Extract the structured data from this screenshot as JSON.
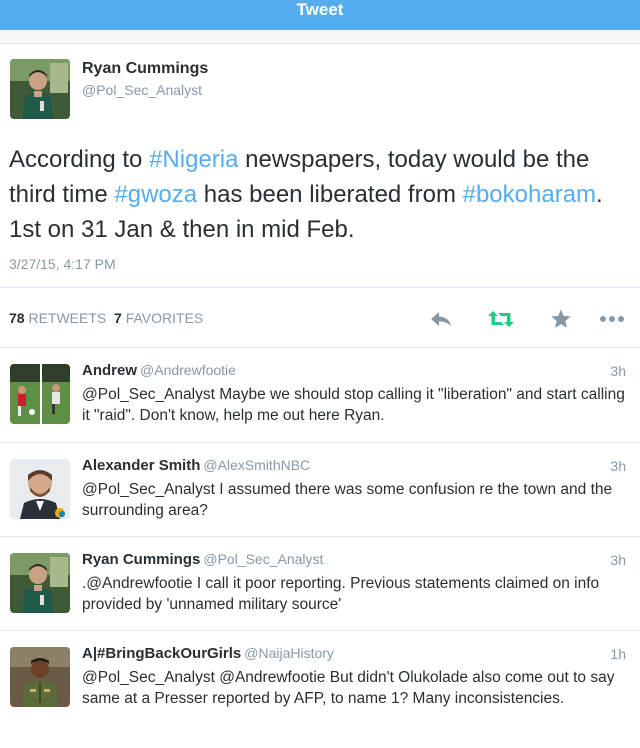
{
  "header": {
    "title": "Tweet"
  },
  "main_tweet": {
    "name": "Ryan Cummings",
    "handle": "@Pol_Sec_Analyst",
    "text_parts": [
      "According to ",
      "#Nigeria",
      " newspapers, today would be the third time ",
      "#gwoza",
      " has been liberated from ",
      "#bokoharam",
      ". 1st on 31 Jan & then in mid Feb."
    ],
    "timestamp": "3/27/15, 4:17 PM",
    "retweets_count": "78",
    "retweets_label": "RETWEETS",
    "favorites_count": "7",
    "favorites_label": "FAVORITES",
    "actions": [
      "reply-icon",
      "retweet-icon",
      "favorite-icon",
      "more-icon"
    ],
    "colors": {
      "accent": "#55acee",
      "retweet_green": "#19cf86",
      "muted": "#8899a6",
      "action_gray": "#8899a6"
    }
  },
  "replies": [
    {
      "name": "Andrew",
      "handle": "@Andrewfootie",
      "time": "3h",
      "text": "@Pol_Sec_Analyst Maybe we should stop calling it \"liberation\" and start calling it \"raid\". Don't know, help me out here Ryan."
    },
    {
      "name": "Alexander Smith",
      "handle": "@AlexSmithNBC",
      "time": "3h",
      "text": "@Pol_Sec_Analyst I assumed there was some confusion re the town and the surrounding area?"
    },
    {
      "name": "Ryan Cummings",
      "handle": "@Pol_Sec_Analyst",
      "time": "3h",
      "text": ".@Andrewfootie I call it poor reporting. Previous statements claimed on info provided by 'unnamed military source'"
    },
    {
      "name": "A|#BringBackOurGirls",
      "handle": "@NaijaHistory",
      "time": "1h",
      "text": "@Pol_Sec_Analyst @Andrewfootie But didn't Olukolade also come out to say same at a Presser reported by AFP, to name 1? Many inconsistencies."
    }
  ]
}
